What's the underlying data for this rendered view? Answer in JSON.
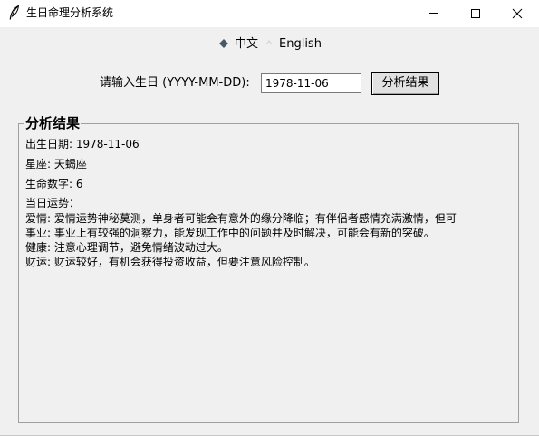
{
  "window": {
    "title": "生日命理分析系统",
    "icon": "feather-icon"
  },
  "language": {
    "options": [
      {
        "label": "中文",
        "selected": true
      },
      {
        "label": "English",
        "selected": false
      }
    ]
  },
  "form": {
    "birthday_label": "请输入生日 (YYYY-MM-DD):",
    "birthday_value": "1978-11-06",
    "analyze_button": "分析结果"
  },
  "results": {
    "group_title": "分析结果",
    "birth_date": "出生日期: 1978-11-06",
    "zodiac": "星座: 天蝎座",
    "life_number": "生命数字: 6",
    "daily_fortune_heading": "当日运势：",
    "love": "爱情: 爱情运势神秘莫测，单身者可能会有意外的缘分降临；有伴侣者感情充满激情，但可",
    "career": "事业: 事业上有较强的洞察力，能发现工作中的问题并及时解决，可能会有新的突破。",
    "health": "健康: 注意心理调节，避免情绪波动过大。",
    "wealth": "财运: 财运较好，有机会获得投资收益，但要注意风险控制。"
  }
}
